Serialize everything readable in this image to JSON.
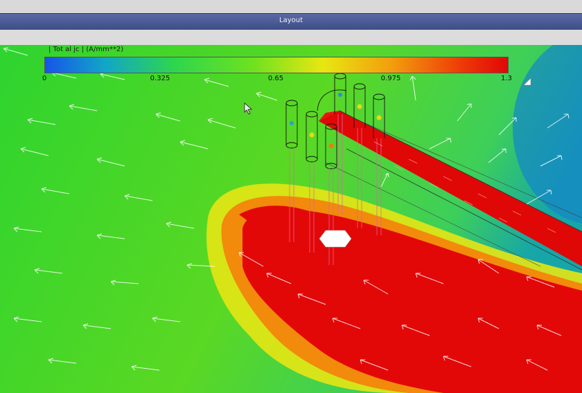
{
  "window": {
    "title": "Layout"
  },
  "legend": {
    "title": "| Tot al jc | (A/mm**2)",
    "ticks": [
      "0",
      "0.325",
      "0.65",
      "0.975",
      "1.3"
    ],
    "min": 0,
    "max": 1.3,
    "colors": [
      "#1655e8",
      "#12a6c8",
      "#2ed64d",
      "#6ee21e",
      "#e8e712",
      "#f29d0d",
      "#ee3a07",
      "#e00707"
    ]
  },
  "viewport": {
    "icons": [
      "mouse-pointer-icon",
      "resize-corner-icon"
    ]
  }
}
